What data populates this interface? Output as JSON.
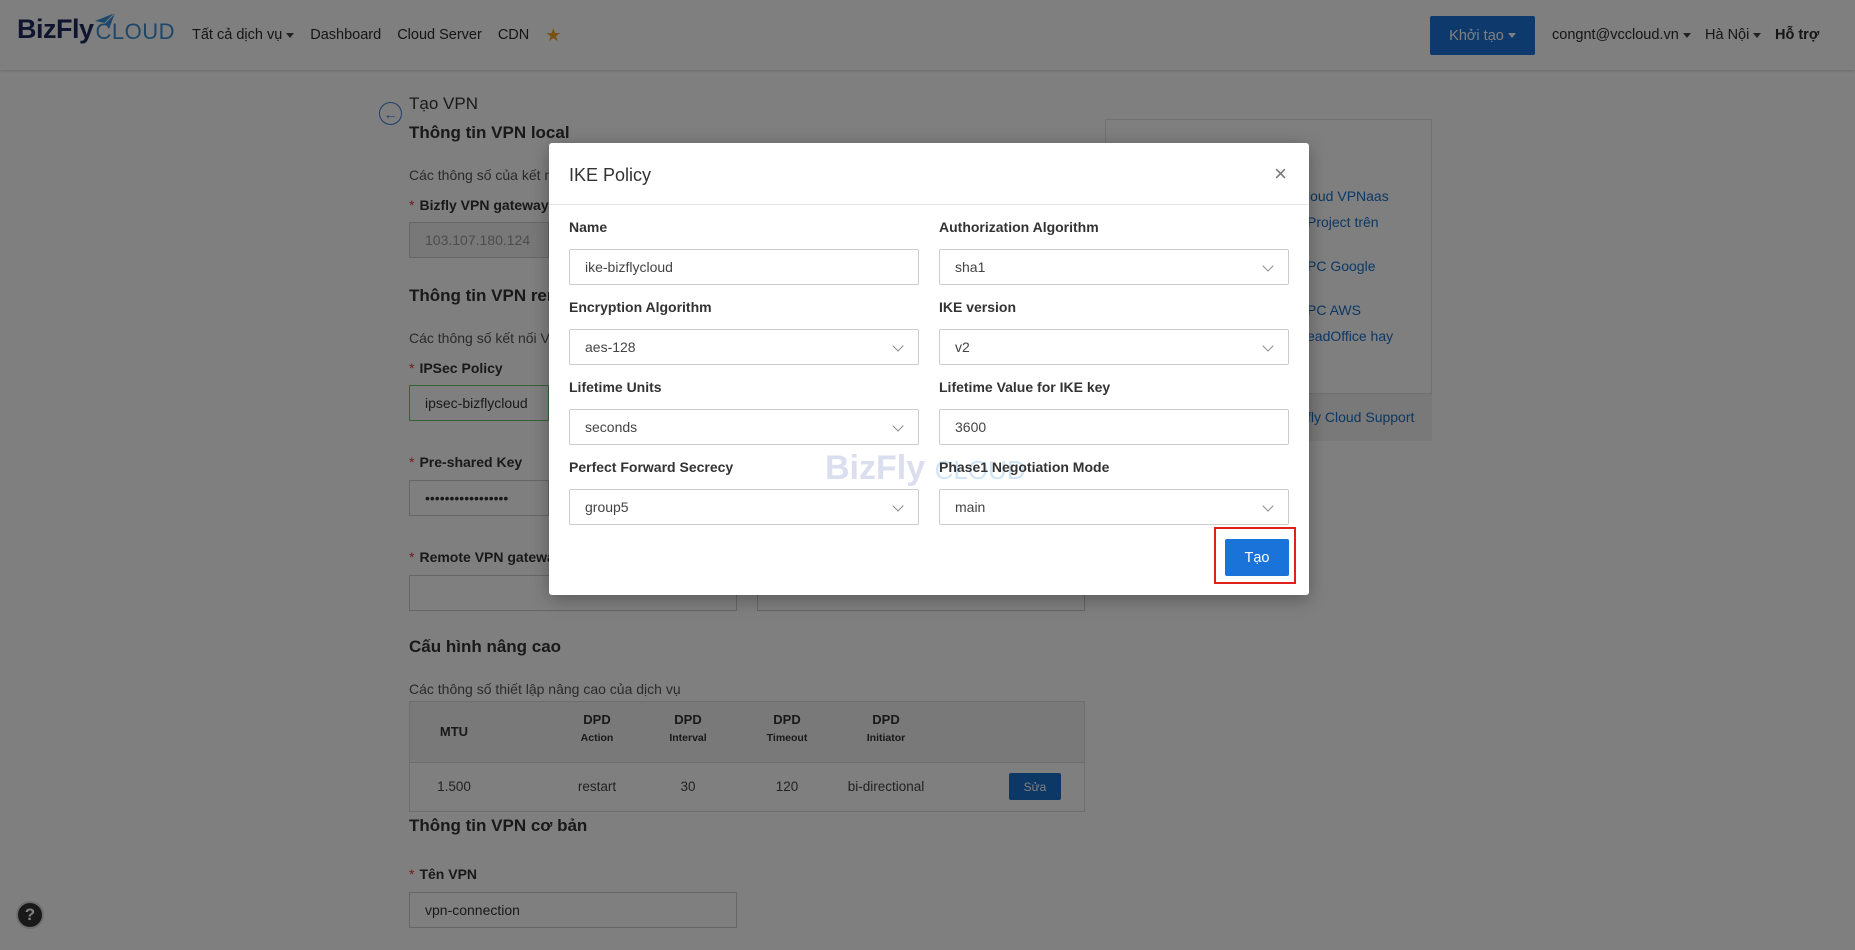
{
  "header": {
    "logo_text": "BizFly",
    "logo_sub": "CLOUD",
    "nav": [
      "Tất cả dịch vụ",
      "Dashboard",
      "Cloud Server",
      "CDN"
    ],
    "create_button": "Khởi tạo",
    "account": "congnt@vccloud.vn",
    "region": "Hà Nội",
    "support": "Hỗ trợ"
  },
  "page": {
    "title": "Tạo VPN",
    "local_section": {
      "title": "Thông tin VPN local",
      "subtitle": "Các thông số của kết n",
      "gateway_label": "Bizfly VPN gateway I",
      "gateway_value": "103.107.180.124"
    },
    "remote_section": {
      "title": "Thông tin VPN rem",
      "subtitle": "Các thông số kết nối VI",
      "ipsec_label": "IPSec Policy",
      "ipsec_value": "ipsec-bizflycloud",
      "psk_label": "Pre-shared Key",
      "psk_value": "•••••••••••••••••",
      "remote_gw_label": "Remote VPN gatewa"
    },
    "advanced": {
      "title": "Cấu hình nâng cao",
      "subtitle": "Các thông số thiết lập nâng cao của dịch vụ",
      "columns": [
        {
          "top": "MTU",
          "sub": ""
        },
        {
          "top": "DPD",
          "sub": "Action"
        },
        {
          "top": "DPD",
          "sub": "Interval"
        },
        {
          "top": "DPD",
          "sub": "Timeout"
        },
        {
          "top": "DPD",
          "sub": "Initiator"
        }
      ],
      "row": [
        "1.500",
        "restart",
        "30",
        "120",
        "bi-directional"
      ],
      "edit_button": "Sửa"
    },
    "basic": {
      "title": "Thông tin VPN cơ bản",
      "name_label": "Tên VPN",
      "name_value": "vpn-connection"
    },
    "side_links": [
      "loud VPNaas",
      "Project trên",
      "PC Google",
      "PC AWS",
      "eadOffice hay"
    ],
    "side_footer": "fly Cloud Support",
    "help_icon": "?"
  },
  "modal": {
    "title": "IKE Policy",
    "close": "×",
    "fields": {
      "name": {
        "label": "Name",
        "value": "ike-bizflycloud"
      },
      "auth": {
        "label": "Authorization Algorithm",
        "value": "sha1"
      },
      "enc": {
        "label": "Encryption Algorithm",
        "value": "aes-128"
      },
      "ike_version": {
        "label": "IKE version",
        "value": "v2"
      },
      "lifetime_units": {
        "label": "Lifetime Units",
        "value": "seconds"
      },
      "lifetime_value": {
        "label": "Lifetime Value for IKE key",
        "value": "3600"
      },
      "pfs": {
        "label": "Perfect Forward Secrecy",
        "value": "group5"
      },
      "phase1": {
        "label": "Phase1 Negotiation Mode",
        "value": "main"
      }
    },
    "watermark": "BizFly",
    "watermark_sub": "CLOUD",
    "submit": "Tạo"
  },
  "colors": {
    "primary": "#1a73d9",
    "highlight": "#e0201c"
  }
}
